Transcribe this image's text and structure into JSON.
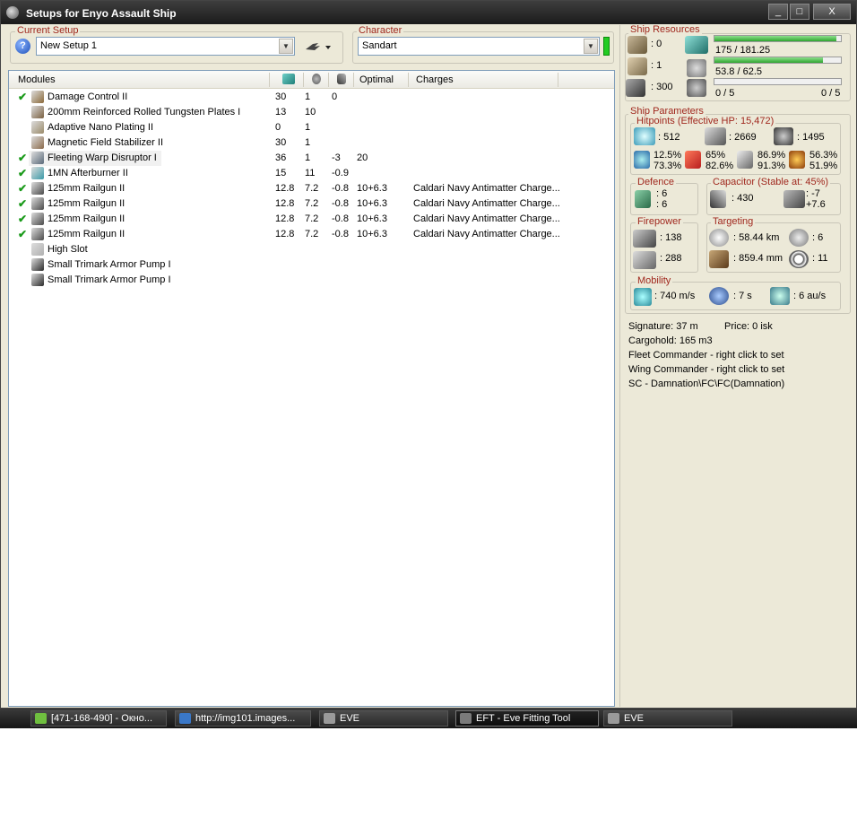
{
  "window": {
    "title": "Setups for Enyo Assault Ship",
    "minimize_label": "_",
    "maximize_label": "□",
    "close_label": "X"
  },
  "setup": {
    "group_label": "Current Setup",
    "help_label": "?",
    "value": "New Setup 1",
    "dropdown_arrow": "▼"
  },
  "character": {
    "group_label": "Character",
    "value": "Sandart",
    "dropdown_arrow": "▼"
  },
  "modules": {
    "headers": {
      "name": "Modules",
      "optimal": "Optimal",
      "charges": "Charges"
    },
    "rows": [
      {
        "check": "✔",
        "name": "Damage Control II",
        "cpu": "30",
        "cap": "1",
        "pg": "0",
        "optimal": "",
        "charges": "",
        "icon_color": "#8b6a3a"
      },
      {
        "check": "",
        "name": "200mm Reinforced Rolled Tungsten Plates I",
        "cpu": "13",
        "cap": "10",
        "pg": "",
        "optimal": "",
        "charges": "",
        "icon_color": "#7a6040"
      },
      {
        "check": "",
        "name": "Adaptive Nano Plating II",
        "cpu": "0",
        "cap": "1",
        "pg": "",
        "optimal": "",
        "charges": "",
        "icon_color": "#9a8a6a"
      },
      {
        "check": "",
        "name": "Magnetic Field Stabilizer II",
        "cpu": "30",
        "cap": "1",
        "pg": "",
        "optimal": "",
        "charges": "",
        "icon_color": "#8a6a4a"
      },
      {
        "check": "✔",
        "name": "Fleeting Warp Disruptor I",
        "cpu": "36",
        "cap": "1",
        "pg": "-3",
        "optimal": "20",
        "charges": "",
        "icon_color": "#5a6a7a"
      },
      {
        "check": "✔",
        "name": "1MN Afterburner II",
        "cpu": "15",
        "cap": "11",
        "pg": "-0.9",
        "optimal": "",
        "charges": "",
        "icon_color": "#3a9aa8"
      },
      {
        "check": "✔",
        "name": "125mm Railgun II",
        "cpu": "12.8",
        "cap": "7.2",
        "pg": "-0.8",
        "optimal": "10+6.3",
        "charges": "Caldari Navy Antimatter Charge...",
        "icon_color": "#4a4a4a"
      },
      {
        "check": "✔",
        "name": "125mm Railgun II",
        "cpu": "12.8",
        "cap": "7.2",
        "pg": "-0.8",
        "optimal": "10+6.3",
        "charges": "Caldari Navy Antimatter Charge...",
        "icon_color": "#4a4a4a"
      },
      {
        "check": "✔",
        "name": "125mm Railgun II",
        "cpu": "12.8",
        "cap": "7.2",
        "pg": "-0.8",
        "optimal": "10+6.3",
        "charges": "Caldari Navy Antimatter Charge...",
        "icon_color": "#4a4a4a"
      },
      {
        "check": "✔",
        "name": "125mm Railgun II",
        "cpu": "12.8",
        "cap": "7.2",
        "pg": "-0.8",
        "optimal": "10+6.3",
        "charges": "Caldari Navy Antimatter Charge...",
        "icon_color": "#4a4a4a"
      },
      {
        "check": "",
        "name": "High Slot",
        "cpu": "",
        "cap": "",
        "pg": "",
        "optimal": "",
        "charges": "",
        "icon_color": "#b0b0b0"
      },
      {
        "check": "",
        "name": "Small Trimark Armor Pump I",
        "cpu": "",
        "cap": "",
        "pg": "",
        "optimal": "",
        "charges": "",
        "icon_color": "#2a2a2a"
      },
      {
        "check": "",
        "name": "Small Trimark Armor Pump I",
        "cpu": "",
        "cap": "",
        "pg": "",
        "optimal": "",
        "charges": "",
        "icon_color": "#2a2a2a"
      }
    ]
  },
  "resources": {
    "group_label": "Ship Resources",
    "turret_slots": ": 0",
    "launcher_slots": ": 1",
    "calibration": ": 300",
    "cpu": {
      "text": "175 / 181.25",
      "fraction": 0.966
    },
    "powergrid": {
      "text": "53.8 / 62.5",
      "fraction": 0.861
    },
    "drones": {
      "left": "0 / 5",
      "right": "0 / 5",
      "fraction": 0.0
    }
  },
  "parameters": {
    "group_label": "Ship Parameters",
    "hitpoints_label": "Hitpoints (Effective HP: 15,472)",
    "shield_hp": ": 512",
    "armor_hp": ": 2669",
    "hull_hp": ": 1495",
    "em": [
      "12.5%",
      "73.3%"
    ],
    "thermal": [
      "65%",
      "82.6%"
    ],
    "kinetic": [
      "86.9%",
      "91.3%"
    ],
    "explosive": [
      "56.3%",
      "51.9%"
    ],
    "defence": {
      "label": "Defence",
      "top": ": 6",
      "bottom": ": 6"
    },
    "capacitor": {
      "label": "Capacitor (Stable at: 45%)",
      "amount": ": 430",
      "delta_top": ": -7",
      "delta_bottom": "+7.6"
    },
    "firepower": {
      "label": "Firepower",
      "turret": ": 138",
      "volley": ": 288"
    },
    "targeting": {
      "label": "Targeting",
      "range": ": 58.44 km",
      "targets": ": 6",
      "resolution": ": 859.4 mm",
      "scan": ": 11"
    },
    "mobility": {
      "label": "Mobility",
      "speed": ": 740 m/s",
      "align": ": 7 s",
      "warp": ": 6 au/s"
    }
  },
  "info": {
    "signature": "Signature: 37 m",
    "price": "Price: 0 isk",
    "cargohold": "Cargohold: 165 m3",
    "fleet_commander": "Fleet Commander - right click to set",
    "wing_commander": "Wing Commander - right click to set",
    "squad_commander": "SC - Damnation\\FC\\FC(Damnation)"
  },
  "taskbar": [
    {
      "label": "[471-168-490] - Окно...",
      "icon_color": "#6fbf3f",
      "active": false
    },
    {
      "label": "http://img101.images...",
      "icon_color": "#3a78c8",
      "active": false
    },
    {
      "label": "EVE",
      "icon_color": "#9a9a9a",
      "active": false
    },
    {
      "label": "EFT - Eve Fitting Tool",
      "icon_color": "#7a7a7a",
      "active": true
    },
    {
      "label": "EVE",
      "icon_color": "#9a9a9a",
      "active": false
    }
  ]
}
